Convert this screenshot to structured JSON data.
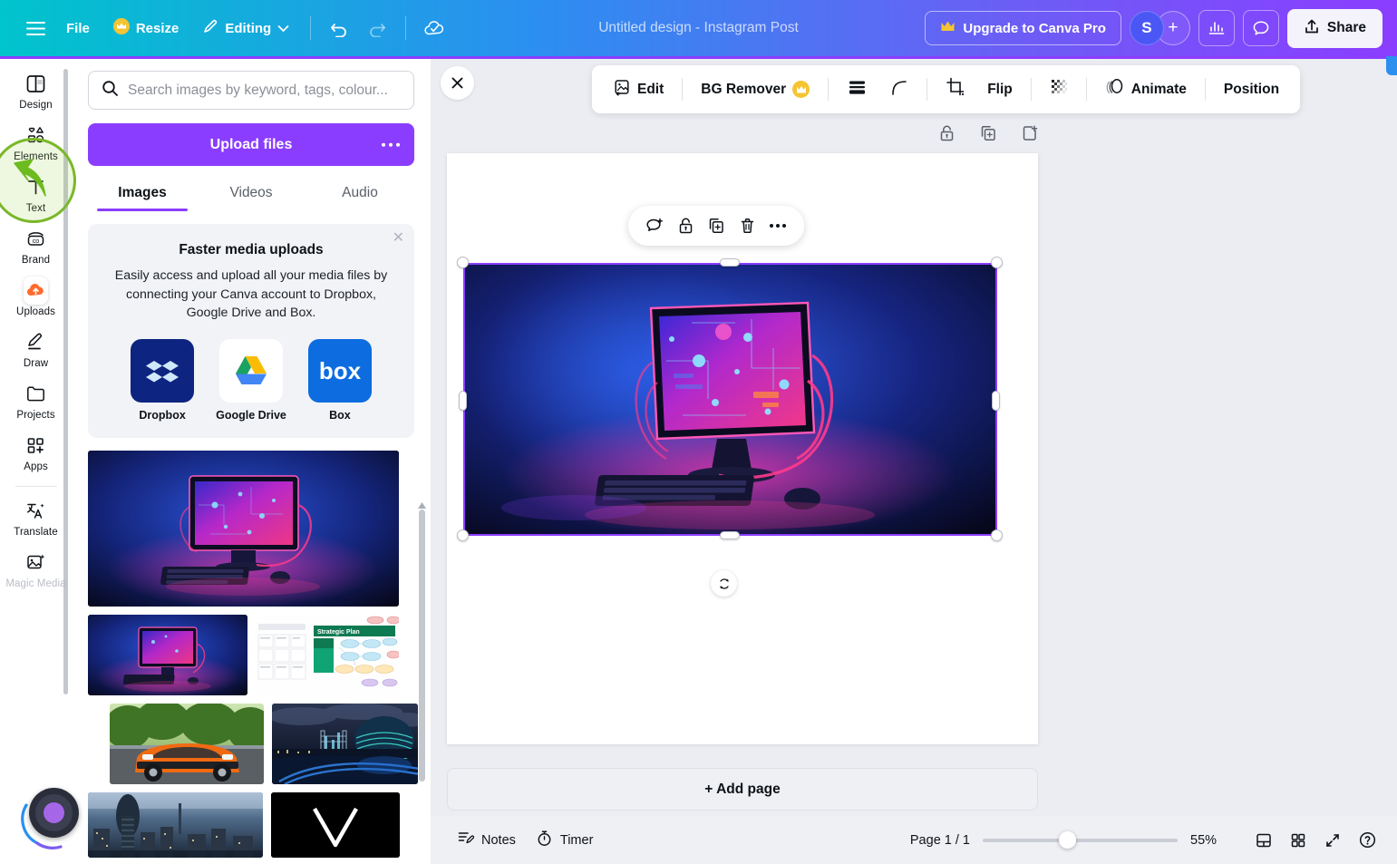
{
  "topbar": {
    "menu_icon": "hamburger-icon",
    "file_label": "File",
    "resize_label": "Resize",
    "editing_label": "Editing",
    "undo_icon": "undo-icon",
    "redo_icon": "redo-icon",
    "cloud_save_icon": "cloud-check-icon",
    "title": "Untitled design - Instagram Post",
    "upgrade_label": "Upgrade to Canva Pro",
    "avatar_initial": "S",
    "add_member_label": "+",
    "insights_icon": "bar-chart-icon",
    "comments_icon": "comment-bubble-icon",
    "share_label": "Share",
    "gradient_start": "#00c4cc",
    "gradient_mid": "#2b8ff0",
    "gradient_end": "#8b3dff"
  },
  "rail": {
    "items": [
      {
        "label": "Design",
        "icon": "design-icon"
      },
      {
        "label": "Elements",
        "icon": "elements-icon"
      },
      {
        "label": "Text",
        "icon": "text-icon"
      },
      {
        "label": "Brand",
        "icon": "brand-icon"
      },
      {
        "label": "Uploads",
        "icon": "uploads-cloud-icon"
      },
      {
        "label": "Draw",
        "icon": "draw-pen-icon"
      },
      {
        "label": "Projects",
        "icon": "projects-folder-icon"
      },
      {
        "label": "Apps",
        "icon": "apps-grid-icon"
      },
      {
        "label": "Translate",
        "icon": "translate-icon"
      },
      {
        "label": "Magic Media",
        "icon": "magic-media-icon"
      }
    ],
    "highlight_color": "#7ab828",
    "highlighted_item": "Elements"
  },
  "panel": {
    "search": {
      "placeholder": "Search images by keyword, tags, colour...",
      "value": "",
      "icon": "search-icon"
    },
    "upload_button": "Upload files",
    "upload_more_icon": "more-options-icon",
    "tabs": [
      {
        "label": "Images",
        "active": true
      },
      {
        "label": "Videos",
        "active": false
      },
      {
        "label": "Audio",
        "active": false
      }
    ],
    "promo": {
      "title": "Faster media uploads",
      "description": "Easily access and upload all your media files by connecting your Canva account to Dropbox, Google Drive and Box.",
      "close_icon": "close-icon",
      "apps": [
        {
          "name": "Dropbox",
          "color": "#0d2481"
        },
        {
          "name": "Google Drive",
          "color": "#ffffff"
        },
        {
          "name": "Box",
          "color": "#0d6ce0"
        }
      ]
    },
    "thumbnails": [
      {
        "name": "neon-computer-large",
        "kind": "image"
      },
      {
        "name": "neon-computer-small",
        "kind": "image"
      },
      {
        "name": "strategic-plan-doc",
        "kind": "image"
      },
      {
        "name": "orange-sports-car",
        "kind": "image"
      },
      {
        "name": "london-city-hall-night",
        "kind": "image"
      },
      {
        "name": "london-skyline-aerial",
        "kind": "image"
      },
      {
        "name": "black-logo-mark",
        "kind": "image"
      }
    ]
  },
  "editor": {
    "close_icon": "close-icon",
    "toolbar": [
      {
        "label": "Edit",
        "icon": "image-edit-icon",
        "pro": false
      },
      {
        "label": "BG Remover",
        "icon": "",
        "pro": true
      },
      {
        "label": "",
        "icon": "filter-lines-icon",
        "pro": false
      },
      {
        "label": "",
        "icon": "corner-radius-icon",
        "pro": false
      },
      {
        "label": "",
        "icon": "crop-icon",
        "pro": false
      },
      {
        "label": "Flip",
        "icon": "",
        "pro": false
      },
      {
        "label": "",
        "icon": "transparency-icon",
        "pro": false
      },
      {
        "label": "Animate",
        "icon": "animate-icon",
        "pro": false
      },
      {
        "label": "Position",
        "icon": "",
        "pro": false
      }
    ],
    "page_controls": [
      {
        "icon": "lock-icon",
        "name": "lock-page-button"
      },
      {
        "icon": "duplicate-icon",
        "name": "duplicate-page-button"
      },
      {
        "icon": "add-page-icon",
        "name": "add-page-button"
      }
    ],
    "float_tools": [
      {
        "icon": "comment-add-icon",
        "name": "add-comment-button"
      },
      {
        "icon": "lock-icon",
        "name": "lock-element-button"
      },
      {
        "icon": "duplicate-icon",
        "name": "duplicate-element-button"
      },
      {
        "icon": "trash-icon",
        "name": "delete-element-button"
      },
      {
        "icon": "more-options-icon",
        "name": "more-options-button"
      }
    ],
    "rotate_icon": "rotate-icon",
    "selection_color": "#8b3dff",
    "add_page_label": "+ Add page",
    "selected_element": "neon-computer-image"
  },
  "statusbar": {
    "notes_label": "Notes",
    "notes_icon": "notes-icon",
    "timer_label": "Timer",
    "timer_icon": "timer-icon",
    "page_indicator": "Page 1 / 1",
    "zoom_level": "55%",
    "zoom_slider_value": 55,
    "grid_view_icon": "page-view-icon",
    "thumbnails_icon": "grid-view-icon",
    "fullscreen_icon": "fullscreen-icon",
    "help_icon": "help-icon"
  }
}
